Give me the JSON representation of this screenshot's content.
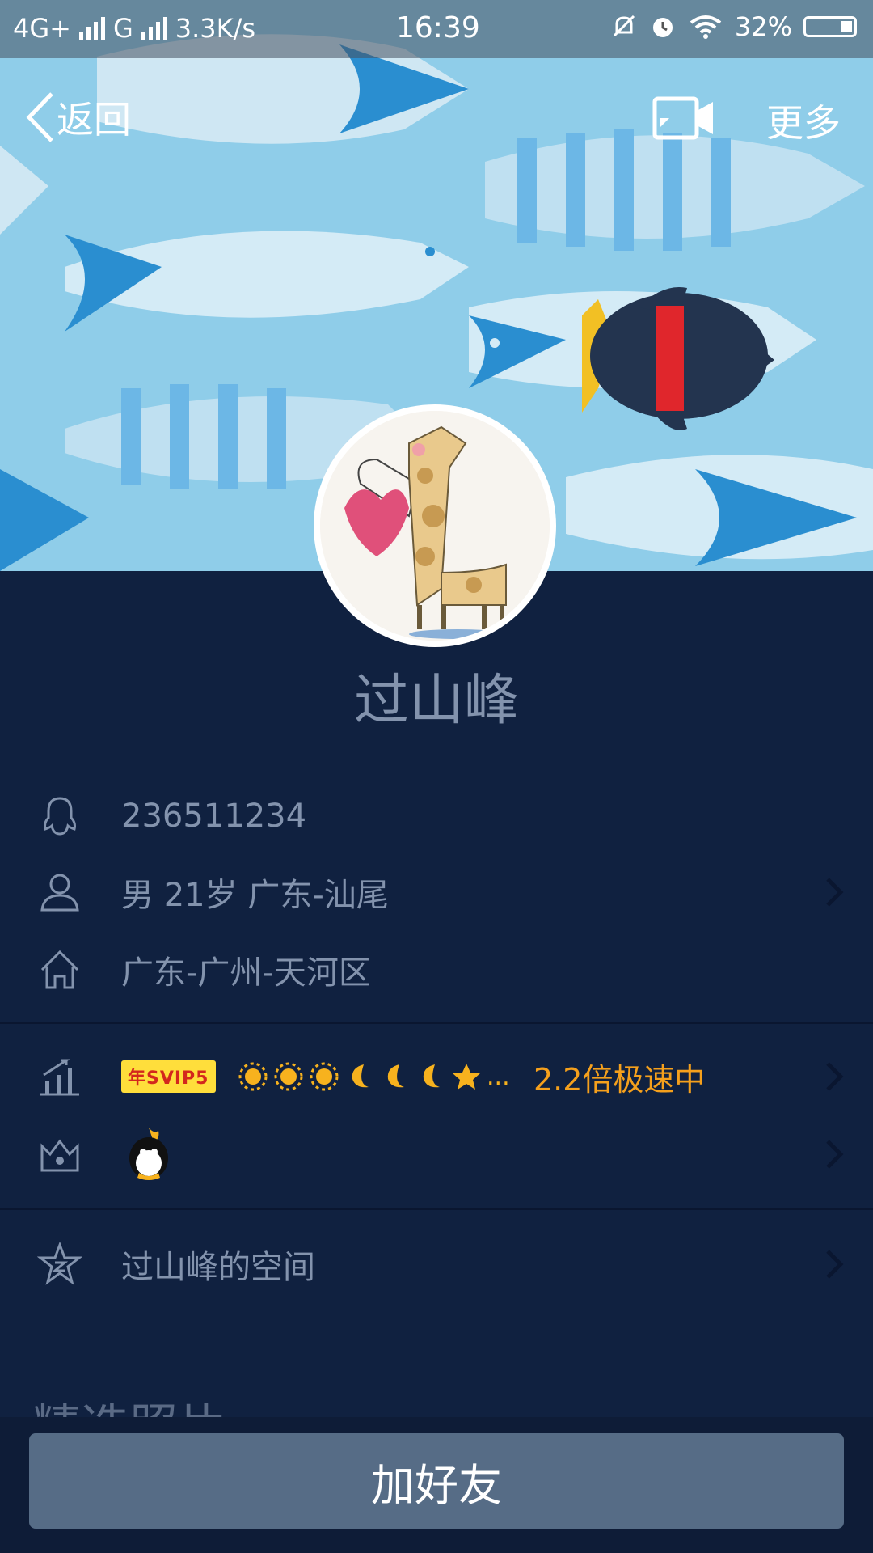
{
  "status_bar": {
    "network1": "4G+",
    "network2": "G",
    "speed": "3.3K/s",
    "time": "16:39",
    "battery": "32%"
  },
  "nav": {
    "back_label": "返回",
    "more_label": "更多"
  },
  "profile": {
    "name": "过山峰",
    "qq_number": "236511234",
    "basic_info": "男  21岁  广东-汕尾",
    "location": "广东-广州-天河区",
    "vip_badge": "年SVIP5",
    "level_suffix": "...",
    "speed_text": "2.2倍极速中",
    "space_label": "过山峰的空间"
  },
  "section": {
    "photos_title": "精选照片"
  },
  "actions": {
    "add_friend": "加好友"
  },
  "colors": {
    "background": "#102140",
    "accent": "#f5a01c",
    "button": "#566c86"
  }
}
